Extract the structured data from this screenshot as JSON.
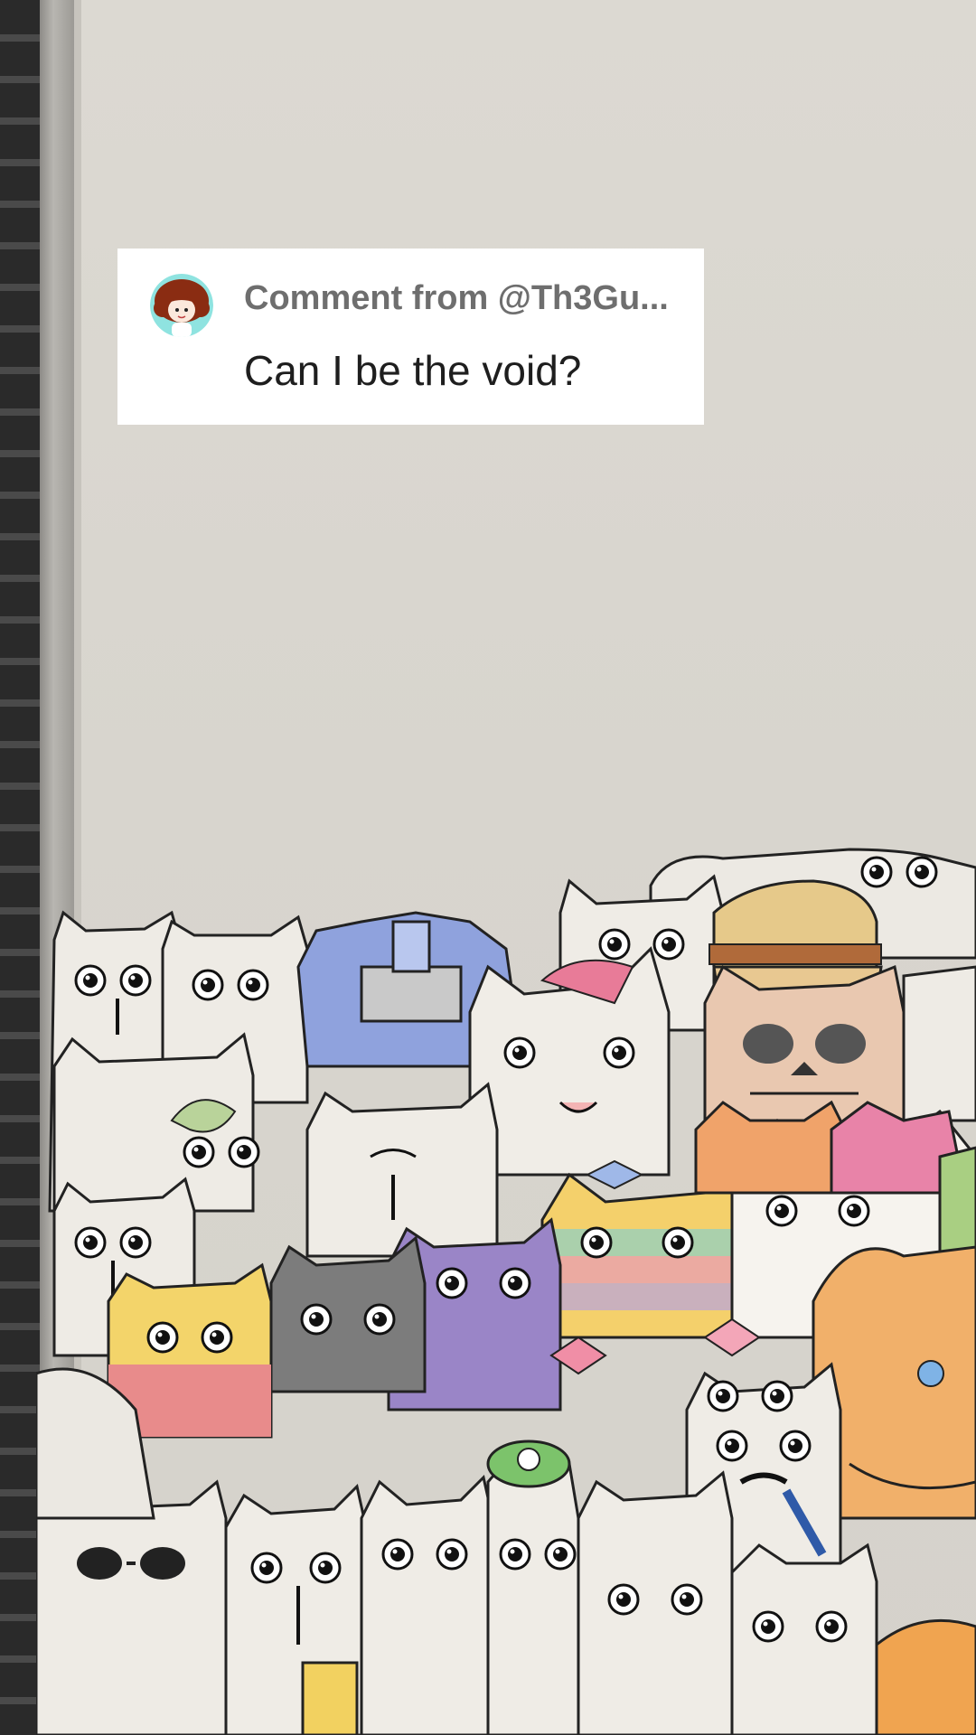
{
  "comment": {
    "from_label": "Comment from @Th3Gu...",
    "text": "Can I be the void?",
    "avatar_icon": "user-avatar-icon"
  },
  "colors": {
    "paper": "#d9d6cf",
    "card_bg": "#ffffff",
    "from_text": "#6e6e6e",
    "body_text": "#1e1e1e"
  }
}
